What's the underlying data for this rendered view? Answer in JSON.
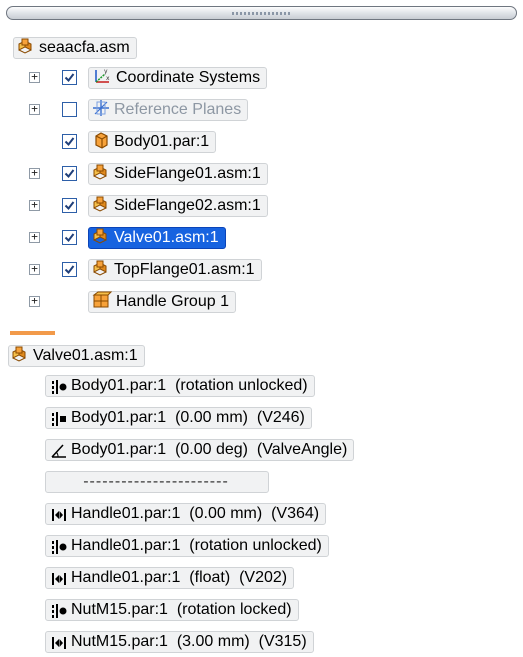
{
  "tree": {
    "root": {
      "label": "seaacfa.asm",
      "icon": "assembly-icon"
    },
    "items": [
      {
        "label": "Coordinate Systems",
        "checked": true,
        "expandable": true,
        "icon": "coordinate-system-icon",
        "state": "normal"
      },
      {
        "label": "Reference Planes",
        "checked": false,
        "expandable": true,
        "icon": "reference-plane-icon",
        "state": "dim"
      },
      {
        "label": "Body01.par:1",
        "checked": true,
        "expandable": false,
        "icon": "part-icon",
        "state": "normal"
      },
      {
        "label": "SideFlange01.asm:1",
        "checked": true,
        "expandable": true,
        "icon": "assembly-icon",
        "state": "normal"
      },
      {
        "label": "SideFlange02.asm:1",
        "checked": true,
        "expandable": true,
        "icon": "assembly-icon",
        "state": "normal"
      },
      {
        "label": "Valve01.asm:1",
        "checked": true,
        "expandable": true,
        "icon": "assembly-icon",
        "state": "selected"
      },
      {
        "label": "TopFlange01.asm:1",
        "checked": true,
        "expandable": true,
        "icon": "assembly-icon",
        "state": "normal"
      },
      {
        "label": "Handle Group 1",
        "checked": null,
        "expandable": true,
        "icon": "group-icon",
        "state": "normal"
      }
    ]
  },
  "relationships": {
    "header": {
      "label": "Valve01.asm:1",
      "icon": "assembly-icon"
    },
    "items": [
      {
        "label": "Body01.par:1  (rotation unlocked)",
        "icon": "axial-align-icon"
      },
      {
        "label": "Body01.par:1  (0.00 mm)  (V246)",
        "icon": "planar-align-icon"
      },
      {
        "label": "Body01.par:1  (0.00 deg)  (ValveAngle)",
        "icon": "angle-icon"
      },
      {
        "label": "-----------------------",
        "icon": "",
        "divider": true
      },
      {
        "label": "Handle01.par:1  (0.00 mm)  (V364)",
        "icon": "mate-icon"
      },
      {
        "label": "Handle01.par:1  (rotation unlocked)",
        "icon": "axial-align-icon"
      },
      {
        "label": "Handle01.par:1  (float)  (V202)",
        "icon": "mate-icon"
      },
      {
        "label": "NutM15.par:1  (rotation locked)",
        "icon": "axial-align-icon"
      },
      {
        "label": "NutM15.par:1  (3.00 mm)  (V315)",
        "icon": "mate-icon"
      }
    ]
  },
  "colors": {
    "accent": "#1763e0",
    "separator": "#f29a4a",
    "icon_orange": "#e08a1e"
  }
}
